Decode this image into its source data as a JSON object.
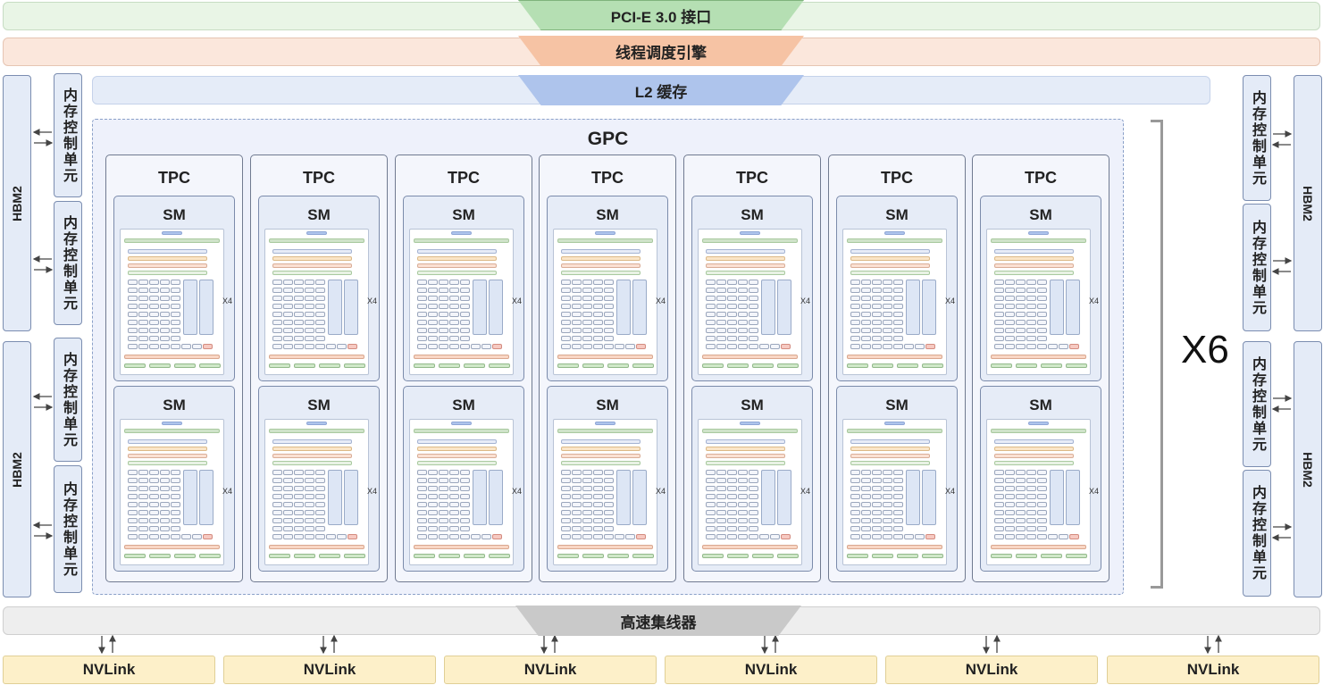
{
  "top": {
    "pcie": "PCI-E 3.0 接口",
    "scheduler": "线程调度引擎",
    "l2": "L2 缓存"
  },
  "left": {
    "hbm": [
      "HBM2",
      "HBM2"
    ],
    "memory_controllers": [
      "内存控制单元",
      "内存控制单元",
      "内存控制单元",
      "内存控制单元"
    ]
  },
  "right": {
    "hbm": [
      "HBM2",
      "HBM2"
    ],
    "memory_controllers": [
      "内存控制单元",
      "内存控制单元",
      "内存控制单元",
      "内存控制单元"
    ]
  },
  "gpc": {
    "title": "GPC",
    "tpc_label": "TPC",
    "sm_label": "SM",
    "sm_repeat": "X4",
    "tpc_count": 7,
    "sm_per_tpc": 2
  },
  "multiplier": "X6",
  "bottom": {
    "hub": "高速集线器",
    "nvlinks": [
      "NVLink",
      "NVLink",
      "NVLink",
      "NVLink",
      "NVLink",
      "NVLink"
    ]
  },
  "colors": {
    "pcie": "#b5dfb3",
    "scheduler": "#f6c3a4",
    "l2": "#aec4ec",
    "hub": "#c9c9c9",
    "nvlink": "#fdf0c9",
    "side_panel": "#e4ebf7"
  }
}
